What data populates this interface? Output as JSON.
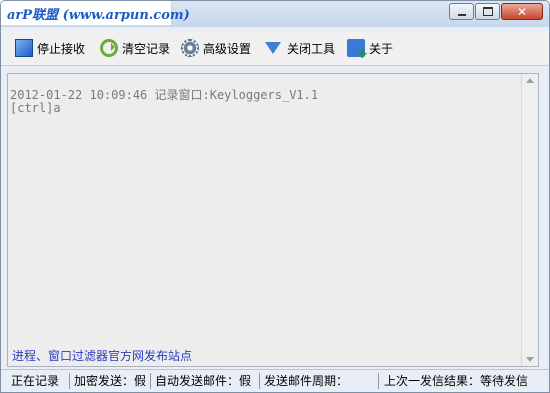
{
  "window": {
    "brand_title": "arP联盟 (www.arpun.com)",
    "buttons": {
      "minimize": "–",
      "maximize": "□",
      "close": "✕"
    }
  },
  "toolbar": {
    "items": [
      {
        "label": "停止接收",
        "icon": "stop-icon"
      },
      {
        "label": "清空记录",
        "icon": "refresh-icon"
      },
      {
        "label": "高级设置",
        "icon": "gear-icon"
      },
      {
        "label": "关闭工具",
        "icon": "filter-icon"
      },
      {
        "label": "关于",
        "icon": "about-icon"
      }
    ]
  },
  "log": {
    "lines": [
      "2012-01-22 10:09:46 记录窗口:Keyloggers_V1.1",
      "[ctrl]a"
    ],
    "link_text": "进程、窗口过滤器官方网发布站点"
  },
  "statusbar": {
    "recording": "正在记录",
    "encrypt_send": "加密发送：假",
    "auto_send_mail": "自动发送邮件：假",
    "send_period": "发送邮件周期：",
    "last_result": "上次一发信结果：等待发信"
  },
  "colors": {
    "accent": "#1e5bc6",
    "link": "#2b3dbd",
    "log_text": "#7a7a7a"
  }
}
